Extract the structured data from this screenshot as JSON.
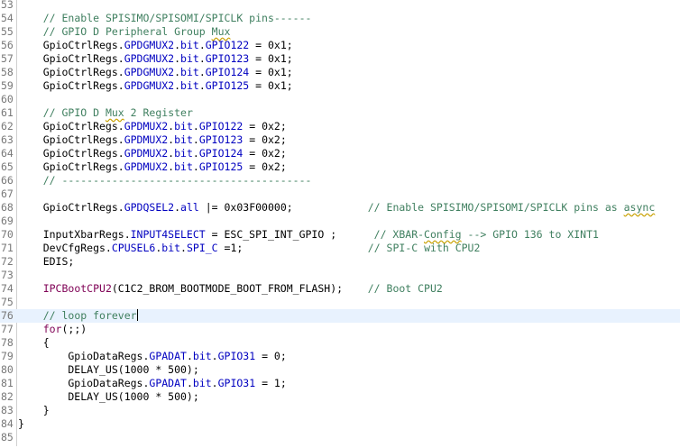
{
  "editor": {
    "lines": [
      {
        "n": "53",
        "segs": []
      },
      {
        "n": "54",
        "segs": [
          {
            "t": "    "
          },
          {
            "t": "// Enable SPISIMO/SPISOMI/SPICLK pins------",
            "c": "comment"
          }
        ]
      },
      {
        "n": "55",
        "segs": [
          {
            "t": "    "
          },
          {
            "t": "// GPIO D Peripheral Group ",
            "c": "comment"
          },
          {
            "t": "Mux",
            "c": "comment spell"
          }
        ]
      },
      {
        "n": "56",
        "segs": [
          {
            "t": "    GpioCtrlRegs."
          },
          {
            "t": "GPDGMUX2",
            "c": "field"
          },
          {
            "t": "."
          },
          {
            "t": "bit",
            "c": "field"
          },
          {
            "t": "."
          },
          {
            "t": "GPIO122",
            "c": "field"
          },
          {
            "t": " = 0x1;"
          }
        ]
      },
      {
        "n": "57",
        "segs": [
          {
            "t": "    GpioCtrlRegs."
          },
          {
            "t": "GPDGMUX2",
            "c": "field"
          },
          {
            "t": "."
          },
          {
            "t": "bit",
            "c": "field"
          },
          {
            "t": "."
          },
          {
            "t": "GPIO123",
            "c": "field"
          },
          {
            "t": " = 0x1;"
          }
        ]
      },
      {
        "n": "58",
        "segs": [
          {
            "t": "    GpioCtrlRegs."
          },
          {
            "t": "GPDGMUX2",
            "c": "field"
          },
          {
            "t": "."
          },
          {
            "t": "bit",
            "c": "field"
          },
          {
            "t": "."
          },
          {
            "t": "GPIO124",
            "c": "field"
          },
          {
            "t": " = 0x1;"
          }
        ]
      },
      {
        "n": "59",
        "segs": [
          {
            "t": "    GpioCtrlRegs."
          },
          {
            "t": "GPDGMUX2",
            "c": "field"
          },
          {
            "t": "."
          },
          {
            "t": "bit",
            "c": "field"
          },
          {
            "t": "."
          },
          {
            "t": "GPIO125",
            "c": "field"
          },
          {
            "t": " = 0x1;"
          }
        ]
      },
      {
        "n": "60",
        "segs": []
      },
      {
        "n": "61",
        "segs": [
          {
            "t": "    "
          },
          {
            "t": "// GPIO D ",
            "c": "comment"
          },
          {
            "t": "Mux",
            "c": "comment spell"
          },
          {
            "t": " 2 Register",
            "c": "comment"
          }
        ]
      },
      {
        "n": "62",
        "segs": [
          {
            "t": "    GpioCtrlRegs."
          },
          {
            "t": "GPDMUX2",
            "c": "field"
          },
          {
            "t": "."
          },
          {
            "t": "bit",
            "c": "field"
          },
          {
            "t": "."
          },
          {
            "t": "GPIO122",
            "c": "field"
          },
          {
            "t": " = 0x2;"
          }
        ]
      },
      {
        "n": "63",
        "segs": [
          {
            "t": "    GpioCtrlRegs."
          },
          {
            "t": "GPDMUX2",
            "c": "field"
          },
          {
            "t": "."
          },
          {
            "t": "bit",
            "c": "field"
          },
          {
            "t": "."
          },
          {
            "t": "GPIO123",
            "c": "field"
          },
          {
            "t": " = 0x2;"
          }
        ]
      },
      {
        "n": "64",
        "segs": [
          {
            "t": "    GpioCtrlRegs."
          },
          {
            "t": "GPDMUX2",
            "c": "field"
          },
          {
            "t": "."
          },
          {
            "t": "bit",
            "c": "field"
          },
          {
            "t": "."
          },
          {
            "t": "GPIO124",
            "c": "field"
          },
          {
            "t": " = 0x2;"
          }
        ]
      },
      {
        "n": "65",
        "segs": [
          {
            "t": "    GpioCtrlRegs."
          },
          {
            "t": "GPDMUX2",
            "c": "field"
          },
          {
            "t": "."
          },
          {
            "t": "bit",
            "c": "field"
          },
          {
            "t": "."
          },
          {
            "t": "GPIO125",
            "c": "field"
          },
          {
            "t": " = 0x2;"
          }
        ]
      },
      {
        "n": "66",
        "segs": [
          {
            "t": "    "
          },
          {
            "t": "// ----------------------------------------",
            "c": "comment"
          }
        ]
      },
      {
        "n": "67",
        "segs": []
      },
      {
        "n": "68",
        "segs": [
          {
            "t": "    GpioCtrlRegs."
          },
          {
            "t": "GPDQSEL2",
            "c": "field"
          },
          {
            "t": "."
          },
          {
            "t": "all",
            "c": "field"
          },
          {
            "t": " |= 0x03F00000;            "
          },
          {
            "t": "// Enable SPISIMO/SPISOMI/SPICLK pins as ",
            "c": "comment"
          },
          {
            "t": "async",
            "c": "comment spell"
          }
        ]
      },
      {
        "n": "69",
        "segs": []
      },
      {
        "n": "70",
        "segs": [
          {
            "t": "    InputXbarRegs."
          },
          {
            "t": "INPUT4SELECT",
            "c": "field"
          },
          {
            "t": " = ESC_SPI_INT_GPIO ;      "
          },
          {
            "t": "// XBAR-",
            "c": "comment"
          },
          {
            "t": "Config",
            "c": "comment spell"
          },
          {
            "t": " --> GPIO 136 to XINT1",
            "c": "comment"
          }
        ]
      },
      {
        "n": "71",
        "segs": [
          {
            "t": "    DevCfgRegs."
          },
          {
            "t": "CPUSEL6",
            "c": "field"
          },
          {
            "t": "."
          },
          {
            "t": "bit",
            "c": "field"
          },
          {
            "t": "."
          },
          {
            "t": "SPI_C",
            "c": "field"
          },
          {
            "t": " =1;                    "
          },
          {
            "t": "// SPI-C with CPU2",
            "c": "comment"
          }
        ]
      },
      {
        "n": "72",
        "segs": [
          {
            "t": "    EDIS;"
          }
        ]
      },
      {
        "n": "73",
        "segs": []
      },
      {
        "n": "74",
        "segs": [
          {
            "t": "    "
          },
          {
            "t": "IPCBootCPU2",
            "c": "kw-light"
          },
          {
            "t": "(C1C2_BROM_BOOTMODE_BOOT_FROM_FLASH);    "
          },
          {
            "t": "// Boot CPU2",
            "c": "comment"
          }
        ]
      },
      {
        "n": "75",
        "segs": []
      },
      {
        "n": "76",
        "segs": [
          {
            "t": "    "
          },
          {
            "t": "// loop forever",
            "c": "comment"
          }
        ],
        "current": true
      },
      {
        "n": "77",
        "segs": [
          {
            "t": "    "
          },
          {
            "t": "for",
            "c": "kw-light"
          },
          {
            "t": "(;;)"
          }
        ]
      },
      {
        "n": "78",
        "segs": [
          {
            "t": "    {"
          }
        ]
      },
      {
        "n": "79",
        "segs": [
          {
            "t": "        GpioDataRegs."
          },
          {
            "t": "GPADAT",
            "c": "field"
          },
          {
            "t": "."
          },
          {
            "t": "bit",
            "c": "field"
          },
          {
            "t": "."
          },
          {
            "t": "GPIO31",
            "c": "field"
          },
          {
            "t": " = 0;"
          }
        ]
      },
      {
        "n": "80",
        "segs": [
          {
            "t": "        DELAY_US(1000 * 500);"
          }
        ]
      },
      {
        "n": "81",
        "segs": [
          {
            "t": "        GpioDataRegs."
          },
          {
            "t": "GPADAT",
            "c": "field"
          },
          {
            "t": "."
          },
          {
            "t": "bit",
            "c": "field"
          },
          {
            "t": "."
          },
          {
            "t": "GPIO31",
            "c": "field"
          },
          {
            "t": " = 1;"
          }
        ]
      },
      {
        "n": "82",
        "segs": [
          {
            "t": "        DELAY_US(1000 * 500);"
          }
        ]
      },
      {
        "n": "83",
        "segs": [
          {
            "t": "    }"
          }
        ]
      },
      {
        "n": "84",
        "segs": [
          {
            "t": "}"
          }
        ]
      },
      {
        "n": "85",
        "segs": []
      }
    ]
  }
}
